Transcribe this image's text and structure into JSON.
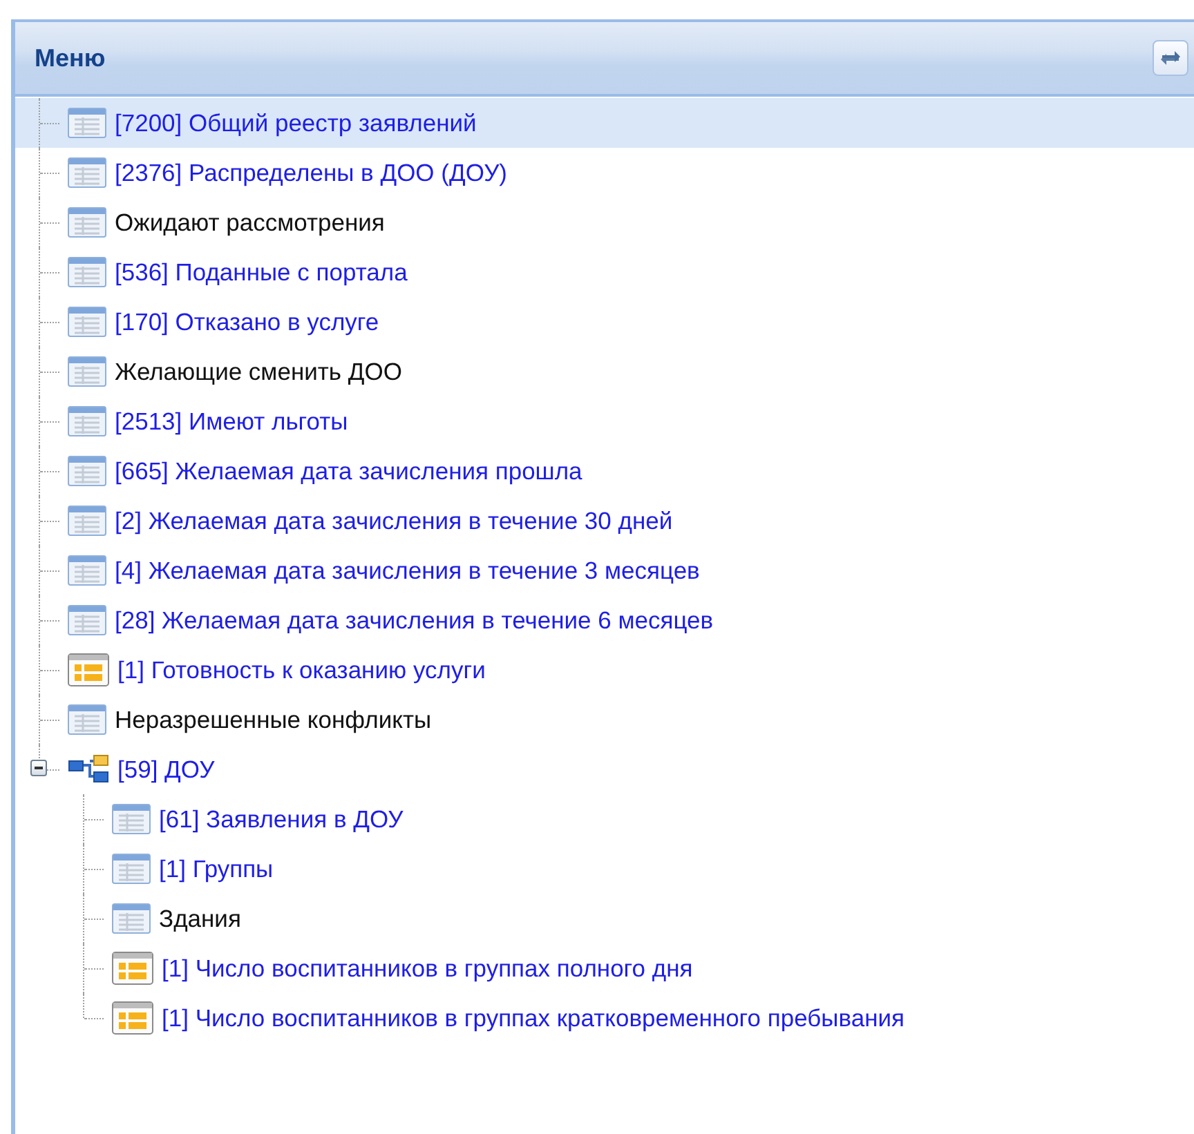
{
  "panel": {
    "title": "Меню"
  },
  "tree": [
    {
      "label": "[7200] Общий реестр заявлений",
      "kind": "table",
      "link": true,
      "selected": true
    },
    {
      "label": "[2376] Распределены в ДОО (ДОУ)",
      "kind": "table",
      "link": true,
      "selected": false
    },
    {
      "label": "Ожидают рассмотрения",
      "kind": "table",
      "link": false,
      "selected": false
    },
    {
      "label": "[536] Поданные с портала",
      "kind": "table",
      "link": true,
      "selected": false
    },
    {
      "label": "[170] Отказано в услуге",
      "kind": "table",
      "link": true,
      "selected": false
    },
    {
      "label": "Желающие сменить ДОО",
      "kind": "table",
      "link": false,
      "selected": false
    },
    {
      "label": "[2513] Имеют льготы",
      "kind": "table",
      "link": true,
      "selected": false
    },
    {
      "label": "[665] Желаемая дата зачисления прошла",
      "kind": "table",
      "link": true,
      "selected": false
    },
    {
      "label": "[2] Желаемая дата зачисления в течение 30 дней",
      "kind": "table",
      "link": true,
      "selected": false
    },
    {
      "label": "[4] Желаемая дата зачисления в течение 3 месяцев",
      "kind": "table",
      "link": true,
      "selected": false
    },
    {
      "label": "[28] Желаемая дата зачисления в течение 6 месяцев",
      "kind": "table",
      "link": true,
      "selected": false
    },
    {
      "label": "[1] Готовность к оказанию услуги",
      "kind": "form",
      "link": true,
      "selected": false
    },
    {
      "label": "Неразрешенные конфликты",
      "kind": "table",
      "link": false,
      "selected": false
    },
    {
      "label": "[59] ДОУ",
      "kind": "folder",
      "link": true,
      "selected": false,
      "expanded": true,
      "children": [
        {
          "label": "[61] Заявления в ДОУ",
          "kind": "table",
          "link": true,
          "selected": false
        },
        {
          "label": "[1] Группы",
          "kind": "table",
          "link": true,
          "selected": false
        },
        {
          "label": "Здания",
          "kind": "table",
          "link": false,
          "selected": false
        },
        {
          "label": "[1] Число воспитанников в группах полного дня",
          "kind": "form",
          "link": true,
          "selected": false
        },
        {
          "label": "[1] Число воспитанников в группах кратковременного пребывания",
          "kind": "form",
          "link": true,
          "selected": false
        }
      ]
    }
  ]
}
